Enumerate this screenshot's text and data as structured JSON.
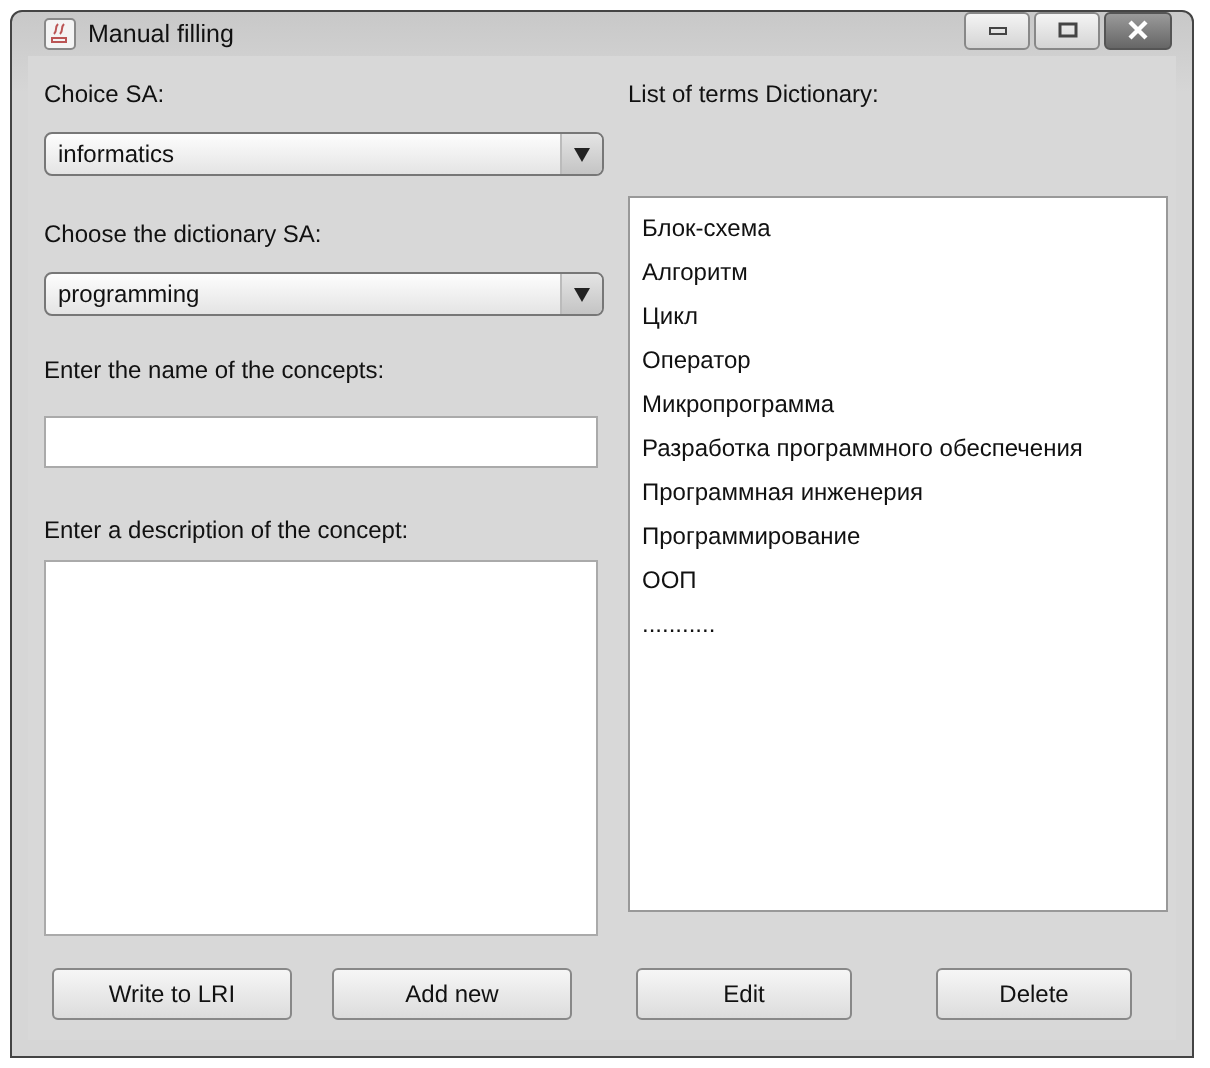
{
  "window": {
    "title": "Manual filling"
  },
  "left": {
    "choice_label": "Choice SA:",
    "choice_value": "informatics",
    "dictionary_label": "Choose the dictionary SA:",
    "dictionary_value": "programming",
    "name_label": "Enter the name of the concepts:",
    "description_label": "Enter a description of the concept:"
  },
  "right": {
    "list_label": "List of terms Dictionary:",
    "terms": [
      "Блок-схема",
      "Алгоритм",
      "Цикл",
      "Оператор",
      "Микропрограмма",
      "Разработка программного обеспечения",
      "Программная инженерия",
      "Программирование",
      "ООП",
      "..........."
    ]
  },
  "buttons": [
    "Write to LRI",
    "Add new",
    "Edit",
    "Delete"
  ]
}
